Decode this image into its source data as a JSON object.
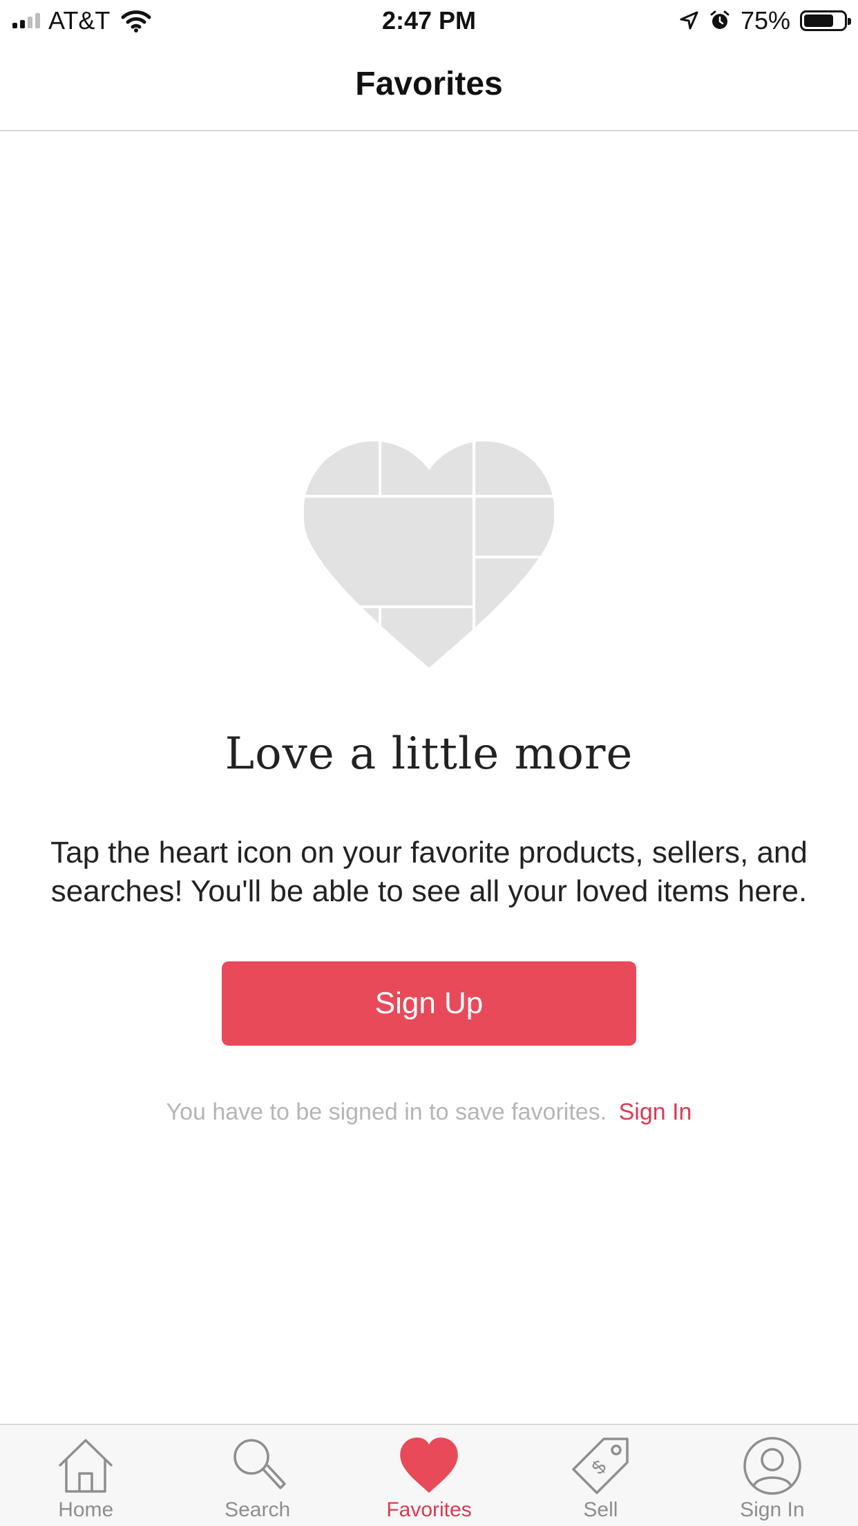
{
  "status_bar": {
    "carrier": "AT&T",
    "time": "2:47 PM",
    "battery_percent": "75%",
    "battery_level": 0.75,
    "icons": [
      "signal-icon",
      "wifi-icon",
      "location-arrow-icon",
      "alarm-icon",
      "battery-icon"
    ]
  },
  "nav": {
    "title": "Favorites"
  },
  "empty_state": {
    "illustration": "heart-collage-icon",
    "title": "Love a little more",
    "description": "Tap the heart icon on your favorite products, sellers, and searches! You'll be able to see all your loved items here.",
    "signup_label": "Sign Up",
    "signin_hint": "You have to be signed in to save favorites.",
    "signin_link": "Sign In"
  },
  "tabs": [
    {
      "label": "Home",
      "icon": "home-icon",
      "active": false
    },
    {
      "label": "Search",
      "icon": "search-icon",
      "active": false
    },
    {
      "label": "Favorites",
      "icon": "heart-icon",
      "active": true
    },
    {
      "label": "Sell",
      "icon": "price-tag-icon",
      "active": false
    },
    {
      "label": "Sign In",
      "icon": "user-icon",
      "active": false
    }
  ],
  "colors": {
    "accent": "#e84a5a",
    "link": "#d83a52",
    "tab_inactive": "#8e8e8e",
    "illustration": "#e2e2e2"
  }
}
